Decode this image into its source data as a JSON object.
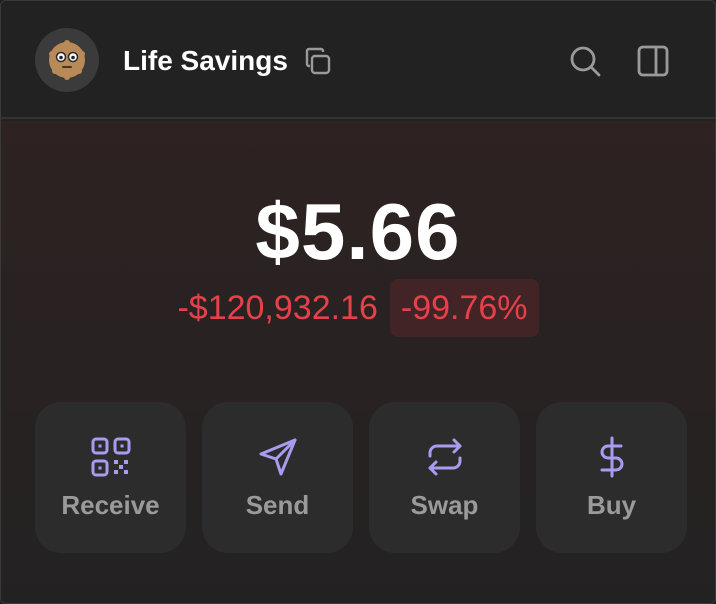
{
  "header": {
    "wallet_name": "Life Savings",
    "avatar_icon": "cookie-face-icon",
    "copy_icon": "copy-icon",
    "search_icon": "search-icon",
    "sidebar_icon": "sidebar-panel-icon"
  },
  "balance": {
    "amount": "$5.66",
    "change_value": "-$120,932.16",
    "change_percent": "-99.76%",
    "change_color": "#e5414a"
  },
  "actions": [
    {
      "label": "Receive",
      "icon": "qr-code-icon"
    },
    {
      "label": "Send",
      "icon": "send-icon"
    },
    {
      "label": "Swap",
      "icon": "swap-icon"
    },
    {
      "label": "Buy",
      "icon": "dollar-icon"
    }
  ],
  "colors": {
    "accent": "#a99bf0",
    "background": "#222222"
  }
}
